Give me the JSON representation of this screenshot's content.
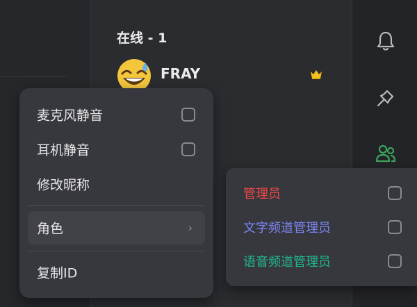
{
  "members": {
    "online_header": "在线 - 1",
    "member": {
      "name": "FRAY",
      "avatar_icon": "grinning-sweat-emoji",
      "badge_icon": "crown-icon"
    }
  },
  "right_rail": {
    "icons": [
      "bell-icon",
      "pin-icon",
      "members-icon"
    ],
    "active_color": "#3ba55c"
  },
  "context_menu": {
    "items": [
      {
        "label": "麦克风静音",
        "checked": false
      },
      {
        "label": "耳机静音",
        "checked": false
      },
      {
        "label": "修改昵称"
      },
      {
        "label": "角色",
        "has_submenu": true
      },
      {
        "label": "复制ID"
      }
    ]
  },
  "roles_submenu": {
    "items": [
      {
        "label": "管理员",
        "color": "#f04747",
        "checked": false
      },
      {
        "label": "文字频道管理员",
        "color": "#7b86f5",
        "checked": false
      },
      {
        "label": "语音频道管理员",
        "color": "#1fb88f",
        "checked": false
      }
    ]
  }
}
